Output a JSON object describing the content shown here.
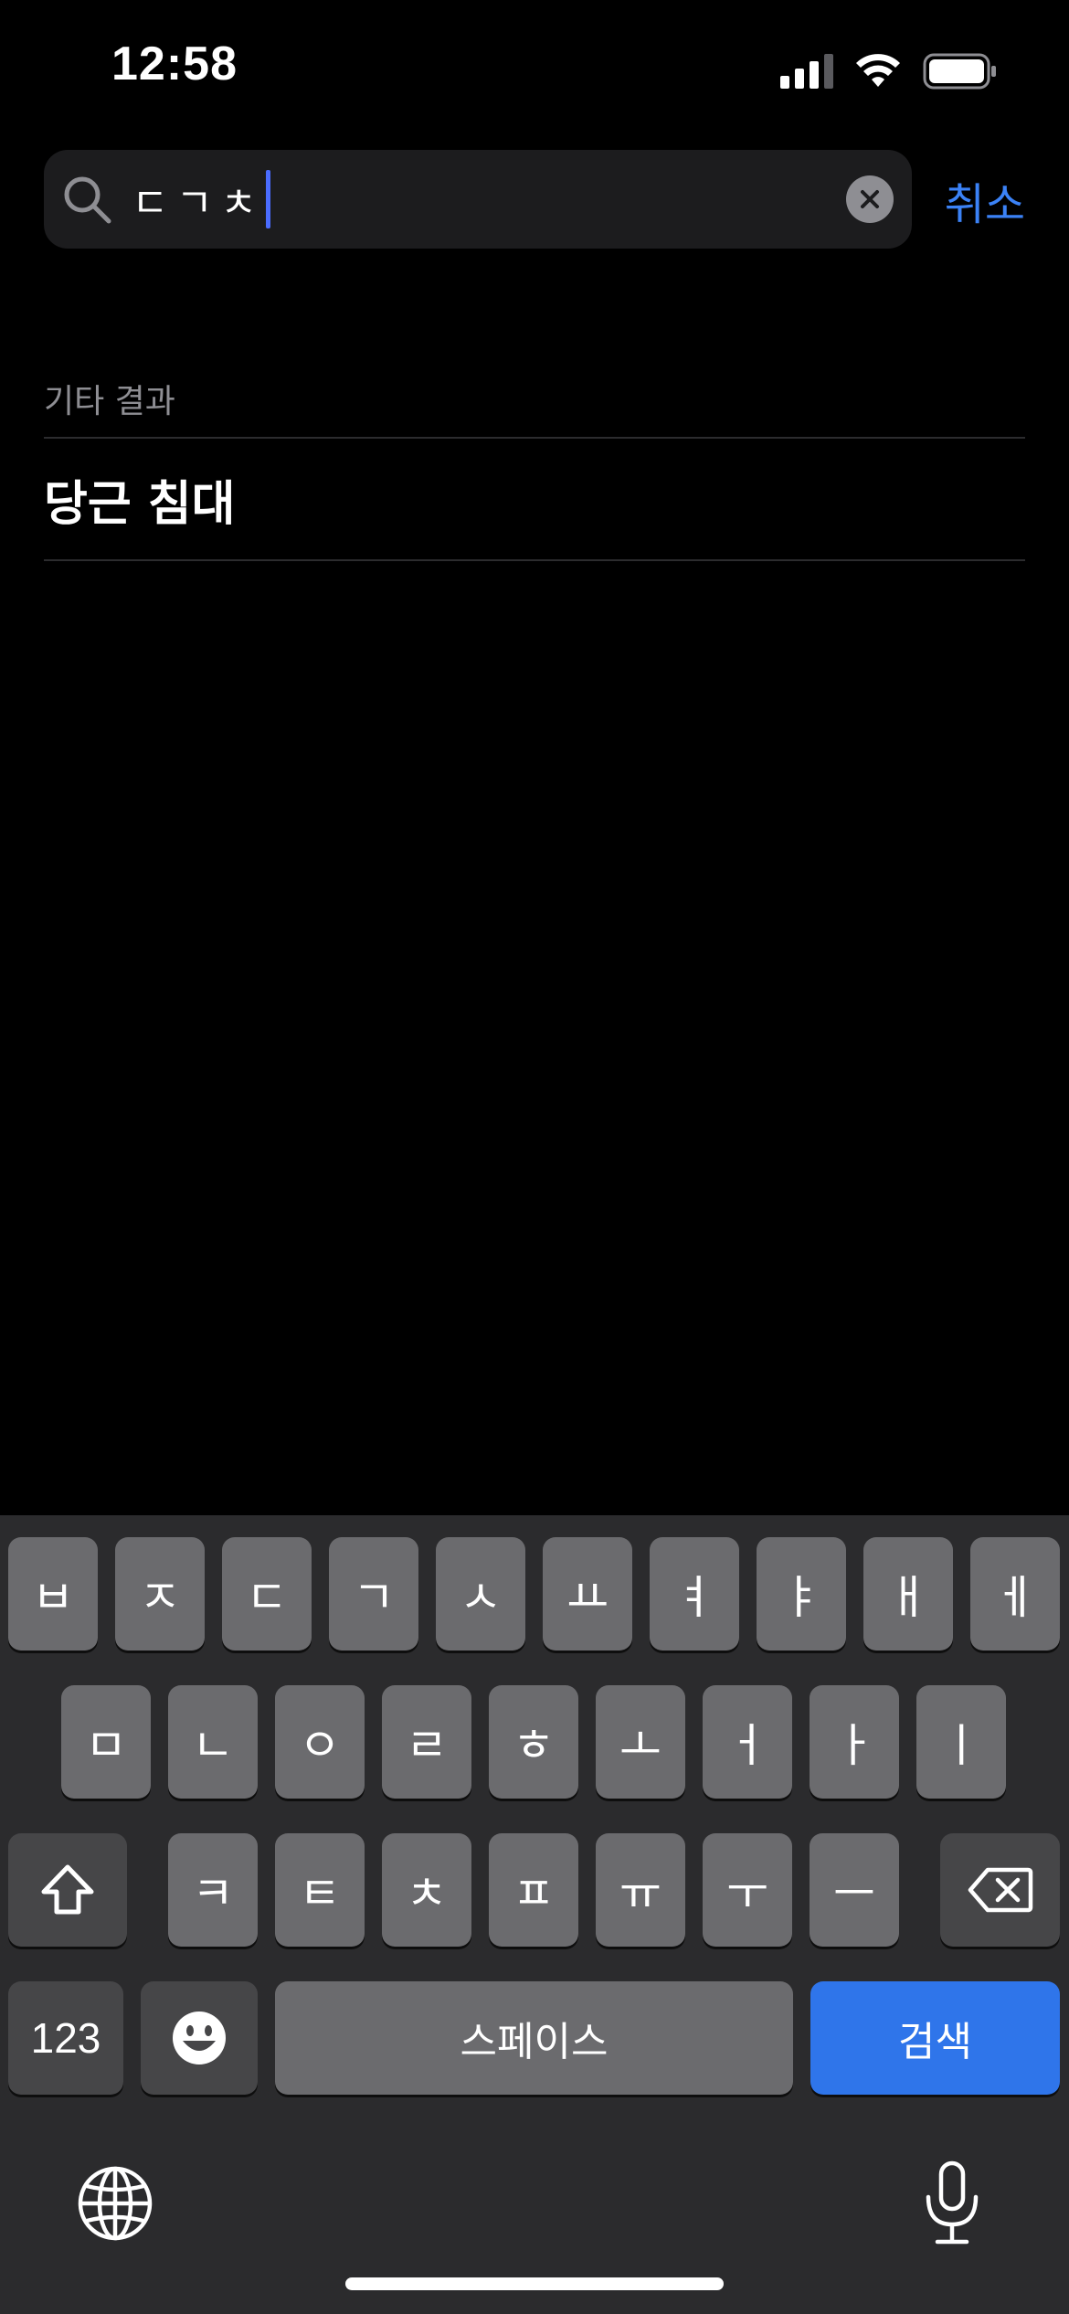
{
  "status_bar": {
    "time": "12:58"
  },
  "search": {
    "query": "ㄷㄱㅊ",
    "cancel_label": "취소"
  },
  "results": {
    "section_header": "기타 결과",
    "items": [
      {
        "label": "당근 침대"
      }
    ]
  },
  "keyboard": {
    "row1": [
      "ㅂ",
      "ㅈ",
      "ㄷ",
      "ㄱ",
      "ㅅ",
      "ㅛ",
      "ㅕ",
      "ㅑ",
      "ㅐ",
      "ㅔ"
    ],
    "row2": [
      "ㅁ",
      "ㄴ",
      "ㅇ",
      "ㄹ",
      "ㅎ",
      "ㅗ",
      "ㅓ",
      "ㅏ",
      "ㅣ"
    ],
    "row3": [
      "ㅋ",
      "ㅌ",
      "ㅊ",
      "ㅍ",
      "ㅠ",
      "ㅜ",
      "ㅡ"
    ],
    "numbers_label": "123",
    "space_label": "스페이스",
    "search_label": "검색",
    "icons": {
      "shift": "shift-icon",
      "backspace": "backspace-icon",
      "emoji": "emoji-icon",
      "globe": "globe-icon",
      "mic": "microphone-icon"
    }
  },
  "colors": {
    "accent": "#3b82f6",
    "search_key": "#2f75ea",
    "caret": "#4a6cff"
  }
}
